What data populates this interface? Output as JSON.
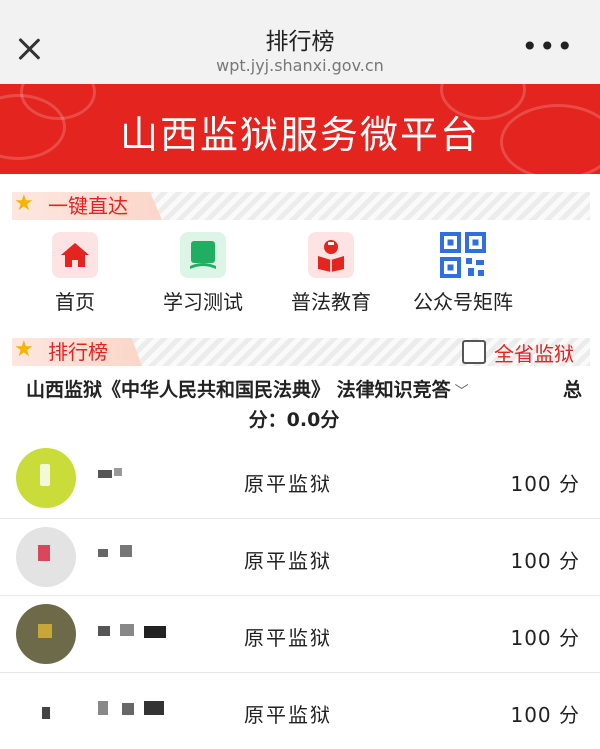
{
  "topbar": {
    "title": "排行榜",
    "url": "wpt.jyj.shanxi.gov.cn",
    "more": "•••"
  },
  "banner": {
    "title": "山西监狱服务微平台"
  },
  "quick_section": {
    "title": "一键直达"
  },
  "quick_links": [
    {
      "label": "首页",
      "icon": "home-icon",
      "color": "#e4241f"
    },
    {
      "label": "学习测试",
      "icon": "book-icon",
      "color": "#1fae62"
    },
    {
      "label": "普法教育",
      "icon": "reader-icon",
      "color": "#e4241f"
    },
    {
      "label": "公众号矩阵",
      "icon": "qr-code-icon",
      "color": "#2f6fe0"
    }
  ],
  "ranking": {
    "title": "排行榜",
    "province_toggle": "全省监狱",
    "contest_name": "山西监狱《中华人民共和国民法典》 法律知识竞答",
    "total_label": "总",
    "total_score_line": "分：0.0分",
    "rows": [
      {
        "prison": "原平监狱",
        "score": "100 分"
      },
      {
        "prison": "原平监狱",
        "score": "100 分"
      },
      {
        "prison": "原平监狱",
        "score": "100 分"
      },
      {
        "prison": "原平监狱",
        "score": "100 分"
      }
    ]
  }
}
